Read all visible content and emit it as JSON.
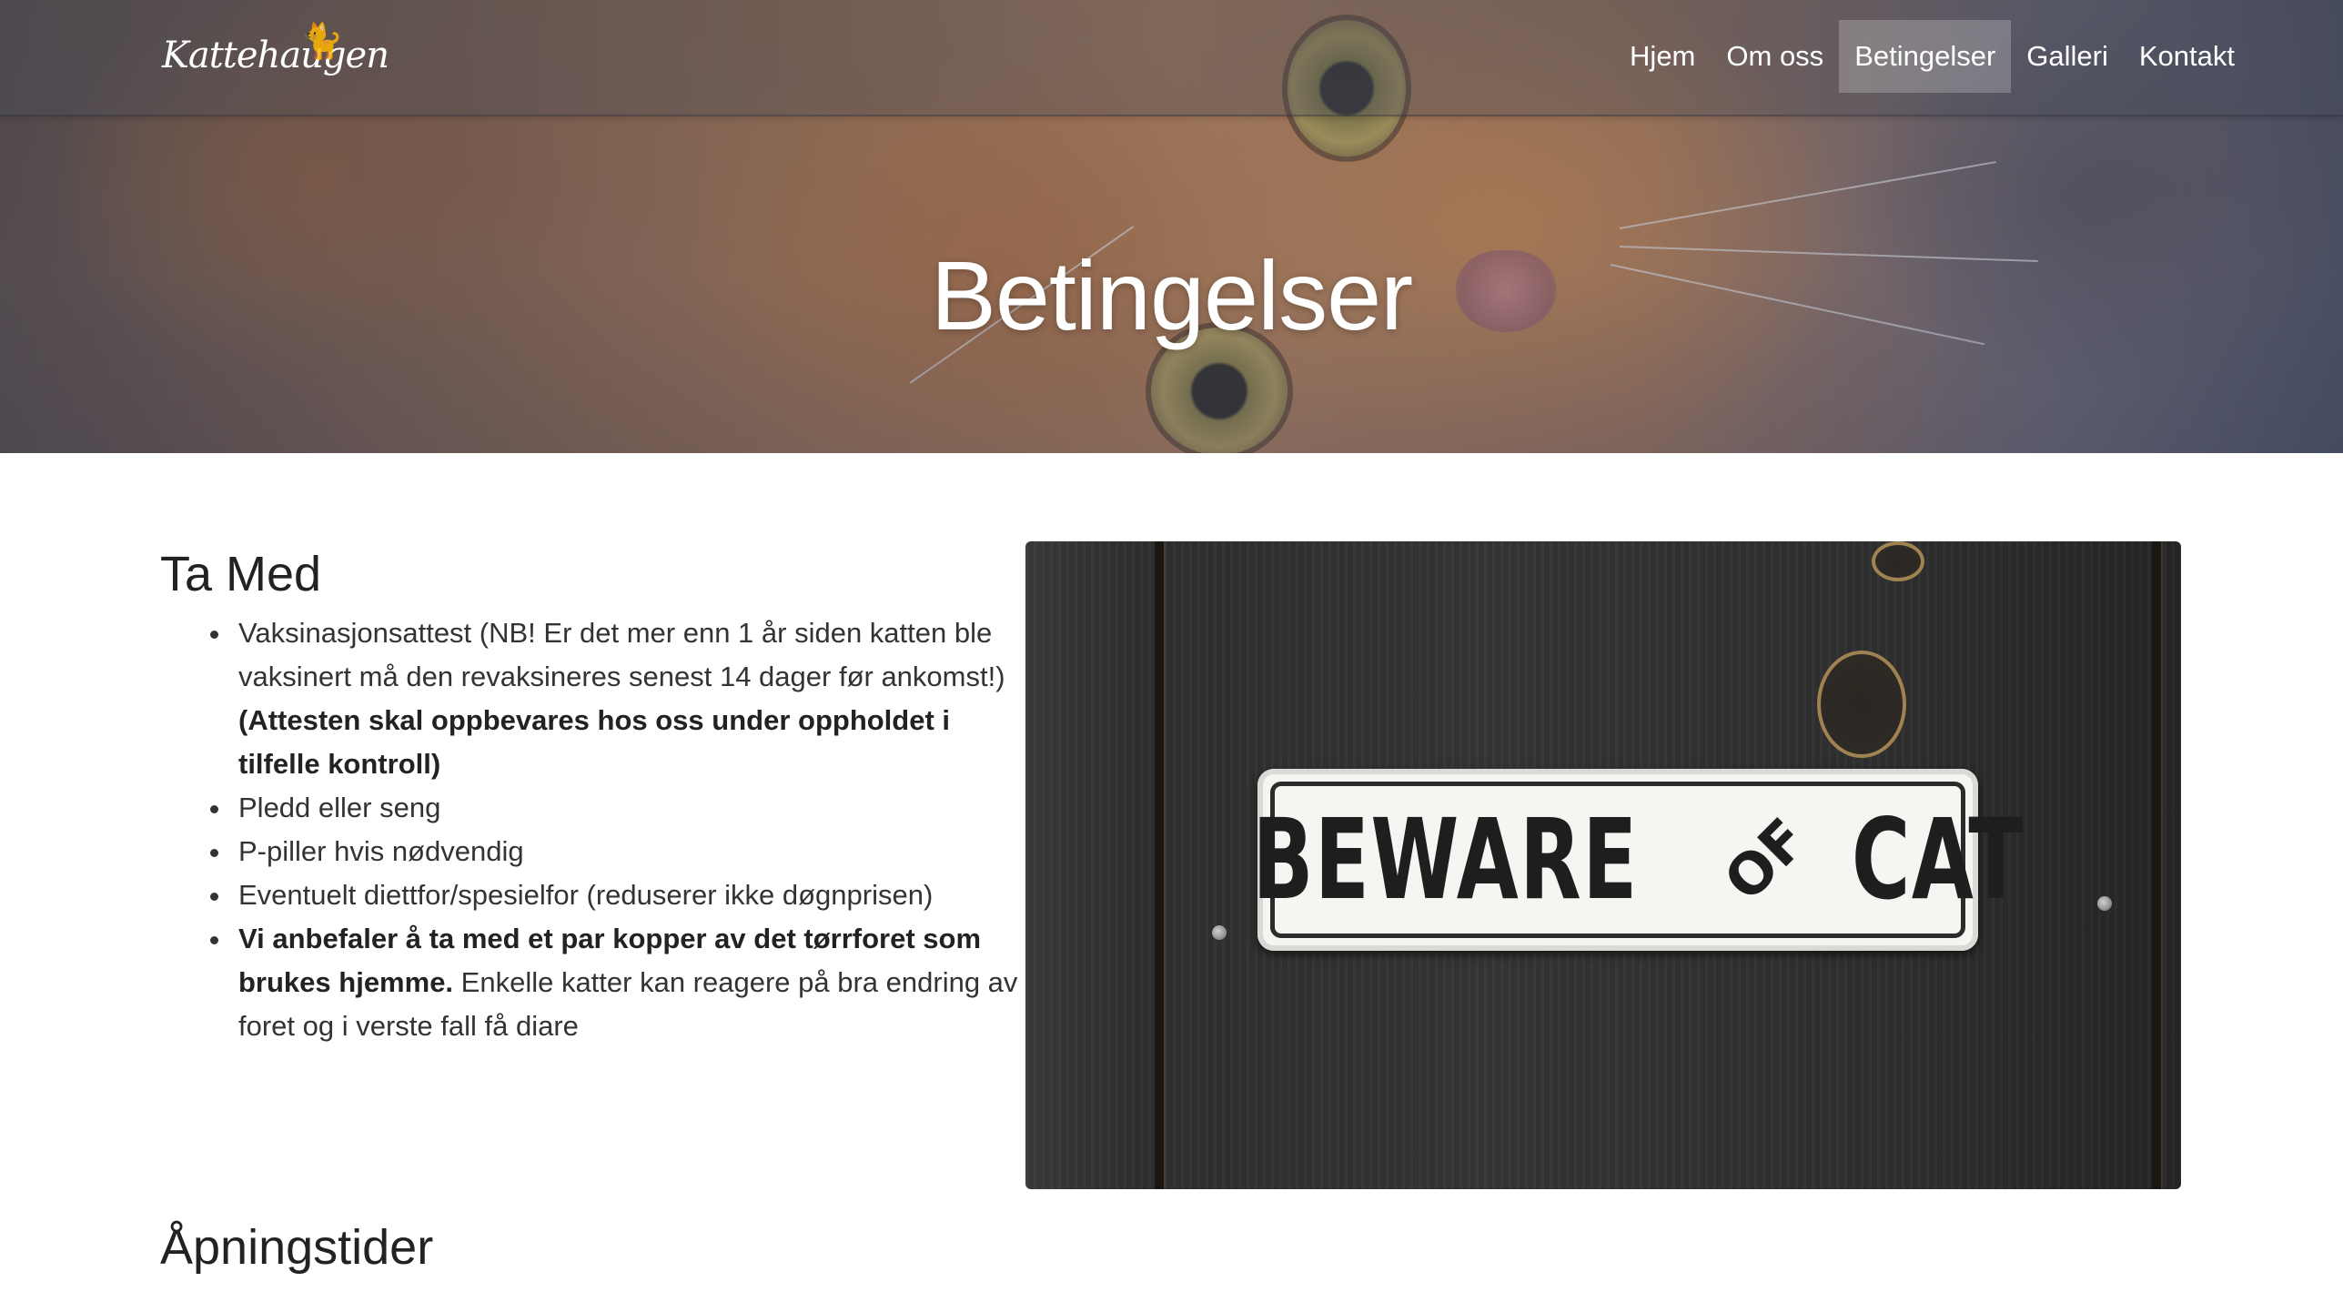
{
  "header": {
    "brand": "Kattehaugen",
    "nav": [
      {
        "label": "Hjem",
        "active": false
      },
      {
        "label": "Om oss",
        "active": false
      },
      {
        "label": "Betingelser",
        "active": true
      },
      {
        "label": "Galleri",
        "active": false
      },
      {
        "label": "Kontakt",
        "active": false
      }
    ]
  },
  "hero": {
    "title": "Betingelser"
  },
  "ta_med": {
    "heading": "Ta Med",
    "items": [
      {
        "text": "Vaksinasjonsattest (NB! Er det mer enn 1 år siden katten ble vaksinert må den revaksineres senest 14 dager før ankomst!) ",
        "bold": "(Attesten skal oppbevares hos oss under oppholdet i tilfelle kontroll)"
      },
      {
        "text": "Pledd eller seng"
      },
      {
        "text": "P-piller hvis nødvendig"
      },
      {
        "text": "Eventuelt diettfor/spesielfor (reduserer ikke døgnprisen)"
      },
      {
        "bold": "Vi anbefaler å ta med et par kopper av det tørrforet som brukes hjemme.",
        "text": " Enkelle katter kan reagere på bra endring av foret og i verste fall få diare"
      }
    ]
  },
  "photo": {
    "sign_words": [
      "BEWARE",
      "OF",
      "CAT"
    ]
  },
  "apningstider": {
    "heading": "Åpningstider"
  },
  "colors": {
    "nav_text": "#ffffff",
    "body_text": "#333333",
    "heading_text": "#222222"
  }
}
